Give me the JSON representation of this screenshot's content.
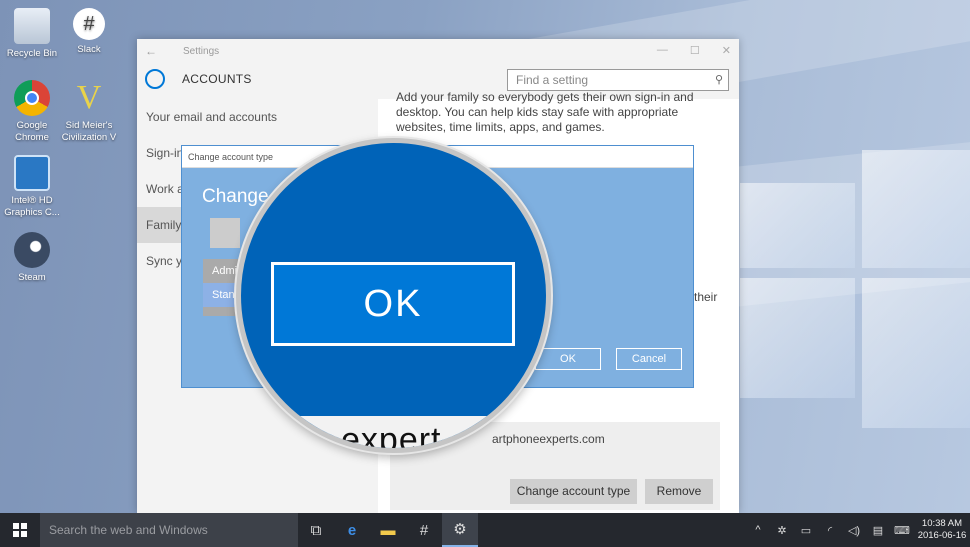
{
  "desktop": {
    "icons": [
      {
        "label": "Recycle Bin"
      },
      {
        "label": "Slack"
      },
      {
        "label": "Google Chrome"
      },
      {
        "label": "Sid Meier's Civilization V"
      },
      {
        "label": "Intel® HD Graphics C..."
      },
      {
        "label": "Steam"
      }
    ]
  },
  "settings": {
    "window_title": "Settings",
    "header": "ACCOUNTS",
    "search_placeholder": "Find a setting",
    "nav": [
      "Your email and accounts",
      "Sign-in",
      "Work a",
      "Family a",
      "Sync yo"
    ],
    "content": {
      "paragraph": "Add your family so everybody gets their own sign-in and desktop. You can help kids stay safe with appropriate websites, time limits, apps, and games.",
      "their_fragment": "their",
      "account_email": "artphoneexperts.com",
      "change_type_button": "Change account type",
      "remove_button": "Remove"
    }
  },
  "dialog": {
    "title": "Change account type",
    "heading": "Change",
    "options": [
      "Admi",
      "Stand"
    ],
    "ok": "OK",
    "cancel": "Cancel"
  },
  "magnifier": {
    "ok_label": "OK",
    "fragment": "expert"
  },
  "taskbar": {
    "search_placeholder": "Search the web and Windows",
    "time": "10:38 AM",
    "date": "2016-06-16"
  }
}
